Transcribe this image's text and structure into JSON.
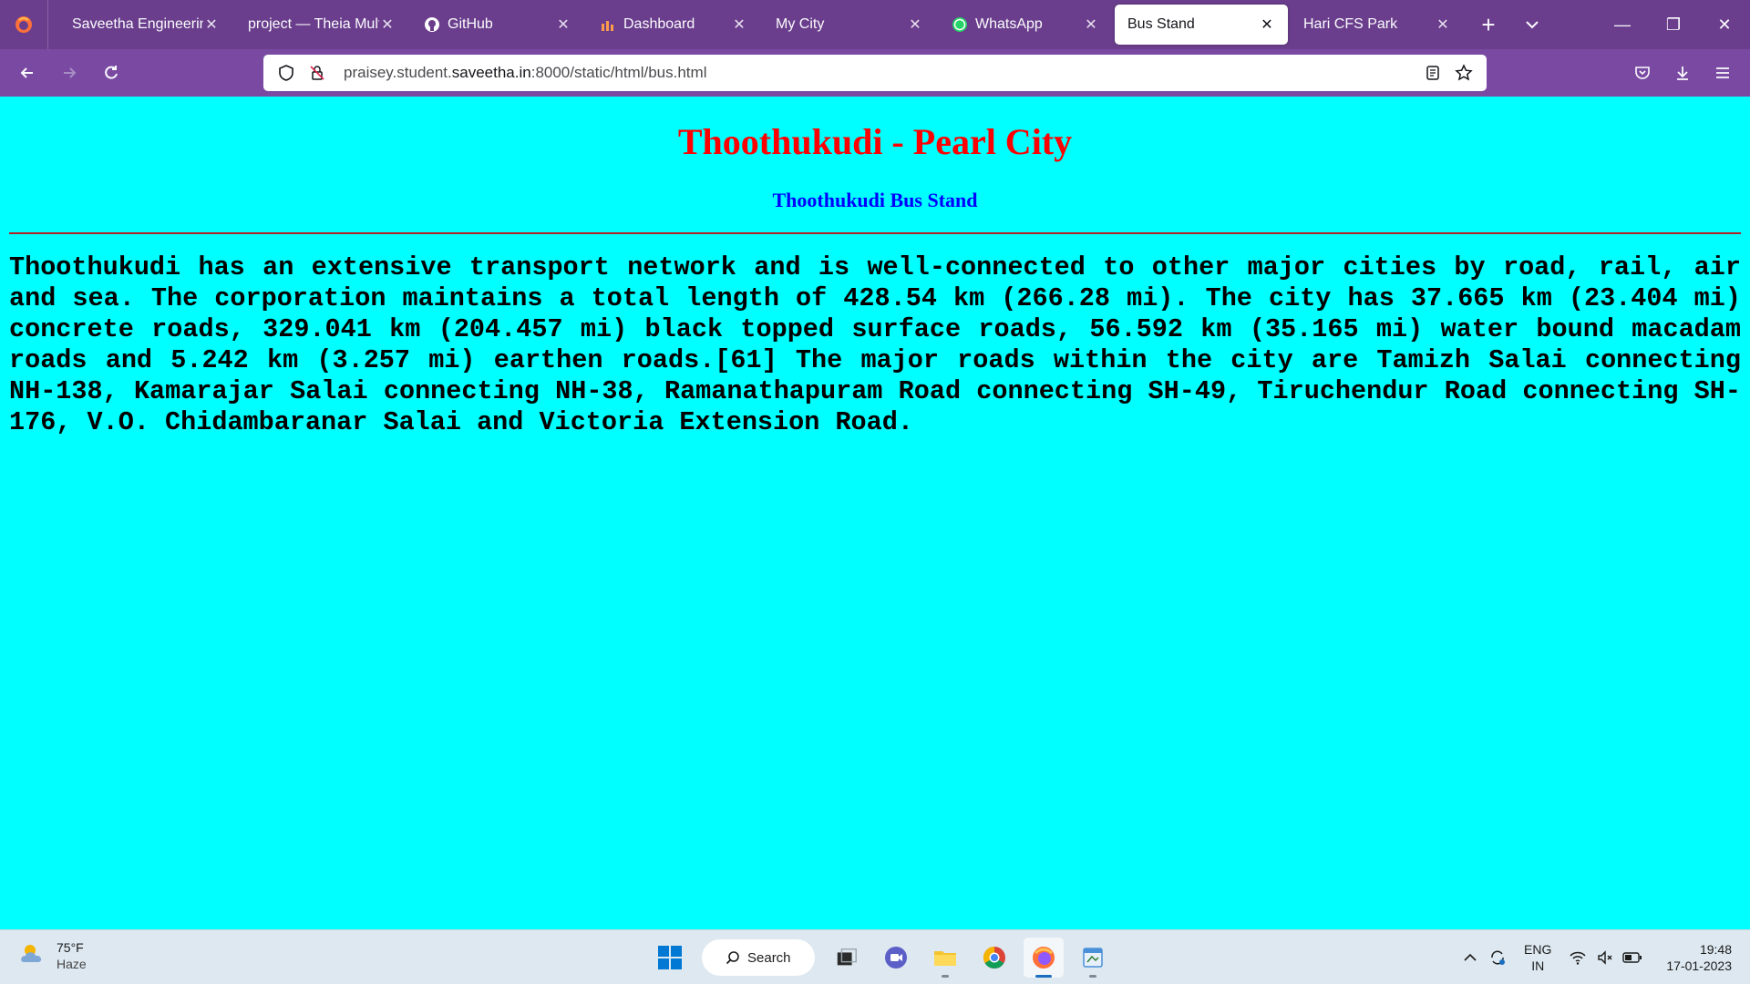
{
  "browser": {
    "tabs": [
      {
        "title": "Saveetha Engineering",
        "icon": "saveetha-icon",
        "active": false
      },
      {
        "title": "project — Theia Multi-",
        "icon": "none",
        "active": false
      },
      {
        "title": "GitHub",
        "icon": "github-icon",
        "active": false
      },
      {
        "title": "Dashboard",
        "icon": "dashboard-icon",
        "active": false
      },
      {
        "title": "My City",
        "icon": "none",
        "active": false
      },
      {
        "title": "WhatsApp",
        "icon": "whatsapp-icon",
        "active": false
      },
      {
        "title": "Bus Stand",
        "icon": "none",
        "active": true
      },
      {
        "title": "Hari CFS Park",
        "icon": "none",
        "active": false
      }
    ],
    "url_prefix": "praisey.student.",
    "url_domain": "saveetha.in",
    "url_suffix": ":8000/static/html/bus.html",
    "accent_color": "#7a4aa3"
  },
  "page": {
    "heading": "Thoothukudi - Pearl City",
    "subheading": "Thoothukudi Bus Stand",
    "paragraph": "Thoothukudi has an extensive transport network and is well-connected to other major cities by road, rail, air and sea. The corporation maintains a total length of 428.54 km (266.28 mi). The city has 37.665 km (23.404 mi) concrete roads, 329.041 km (204.457 mi) black topped surface roads, 56.592 km (35.165 mi) water bound macadam roads and 5.242 km (3.257 mi) earthen roads.[61] The major roads within the city are Tamizh Salai connecting NH-138, Kamarajar Salai connecting NH-38, Ramanathapuram Road connecting SH-49, Tiruchendur Road connecting SH-176, V.O. Chidambaranar Salai and Victoria Extension Road.",
    "background_color": "#00ffff",
    "heading_color": "#ff0000",
    "subheading_color": "#0000ff"
  },
  "taskbar": {
    "weather_temp": "75°F",
    "weather_desc": "Haze",
    "search_label": "Search",
    "lang_top": "ENG",
    "lang_bottom": "IN",
    "time": "19:48",
    "date": "17-01-2023"
  }
}
